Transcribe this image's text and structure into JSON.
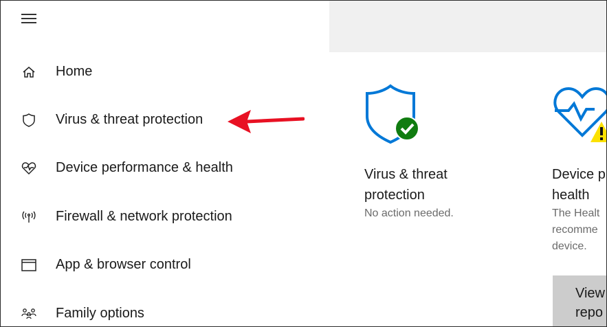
{
  "sidebar": {
    "items": [
      {
        "label": "Home",
        "icon": "home-icon"
      },
      {
        "label": "Virus & threat protection",
        "icon": "shield-icon"
      },
      {
        "label": "Device performance & health",
        "icon": "heart-pulse-icon"
      },
      {
        "label": "Firewall & network protection",
        "icon": "antenna-icon"
      },
      {
        "label": "App & browser control",
        "icon": "browser-window-icon"
      },
      {
        "label": "Family options",
        "icon": "family-icon"
      }
    ]
  },
  "cards": [
    {
      "title_line1": "Virus & threat",
      "title_line2": "protection",
      "status": "No action needed.",
      "icon": "shield-check-icon"
    },
    {
      "title_line1": "Device p",
      "title_line2": "health",
      "status_lines": [
        "The Healt",
        "recomme",
        "device."
      ],
      "icon": "heart-warning-icon",
      "button_line1": "View",
      "button_line2": "repo"
    }
  ],
  "colors": {
    "accent_blue": "#0078d7",
    "ok_green": "#107c10",
    "warning_yellow": "#fce100",
    "arrow_red": "#e81123"
  }
}
